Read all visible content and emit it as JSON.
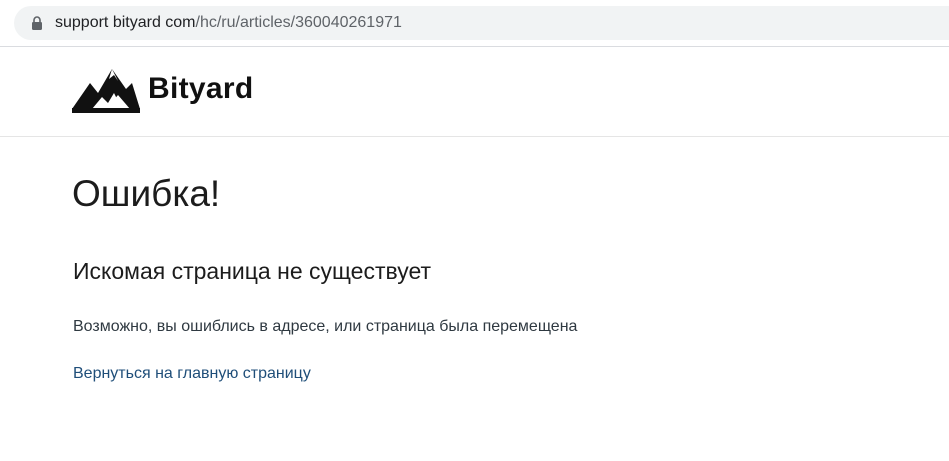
{
  "browser": {
    "url_host": "support bityard com",
    "url_path": "/hc/ru/articles/360040261971"
  },
  "header": {
    "logo_text": "Bityard"
  },
  "main": {
    "title": "Ошибка!",
    "subtitle": "Искомая страница не существует",
    "description": "Возможно, вы ошиблись в адресе, или страница была перемещена",
    "home_link": "Вернуться на главную страницу"
  },
  "colors": {
    "link": "#1f4e79",
    "text": "#1c1c1c",
    "omnibox": "#f1f3f4"
  },
  "icons": {
    "lock": "lock-icon",
    "logo": "mountain-logo-icon"
  }
}
